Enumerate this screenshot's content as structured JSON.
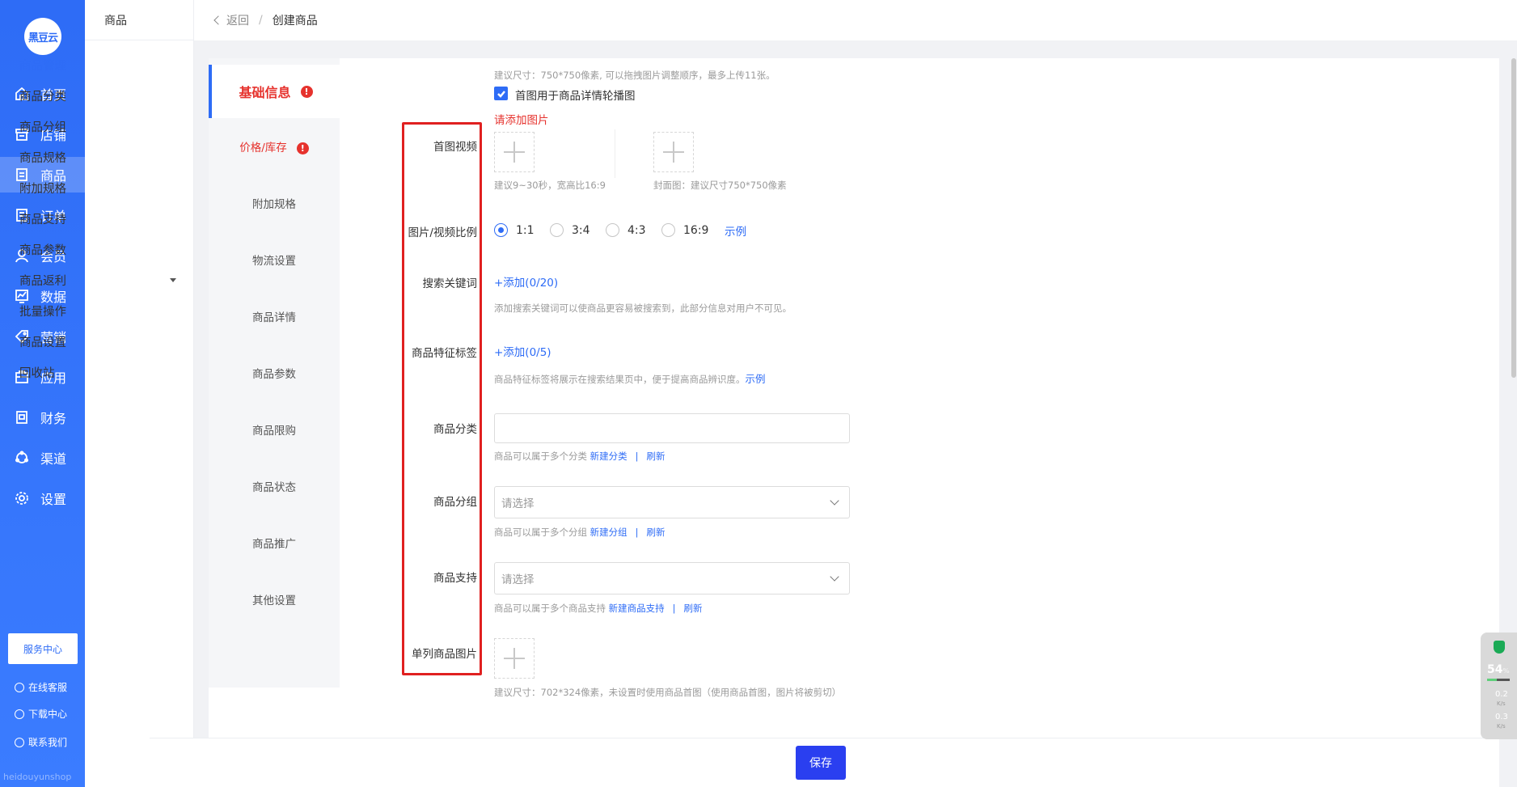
{
  "app": {
    "logo_text": "黑豆云",
    "footer_text": "heidouyunshop"
  },
  "nav": {
    "items": [
      {
        "label": "首页",
        "icon": "home-icon"
      },
      {
        "label": "店铺",
        "icon": "shop-icon"
      },
      {
        "label": "商品",
        "icon": "goods-icon",
        "active": true
      },
      {
        "label": "订单",
        "icon": "order-icon"
      },
      {
        "label": "会员",
        "icon": "member-icon"
      },
      {
        "label": "数据",
        "icon": "chart-icon"
      },
      {
        "label": "营销",
        "icon": "tag-icon"
      },
      {
        "label": "应用",
        "icon": "app-icon"
      },
      {
        "label": "财务",
        "icon": "finance-icon"
      },
      {
        "label": "渠道",
        "icon": "channel-icon"
      },
      {
        "label": "设置",
        "icon": "settings-icon"
      }
    ],
    "service_center": "服务中心",
    "online_service": "在线客服",
    "download_center": "下载中心",
    "contact_us": "联系我们"
  },
  "subnav": {
    "title": "商品",
    "items": [
      "商品管理",
      "商品分类",
      "商品分组",
      "商品规格",
      "附加规格",
      "商品支持",
      "商品参数",
      "商品返利",
      "批量操作",
      "商品设置",
      "回收站"
    ]
  },
  "topbar": {
    "back": "返回",
    "separator": "/",
    "current": "创建商品"
  },
  "tabs": [
    "基础信息",
    "价格/库存",
    "附加规格",
    "物流设置",
    "商品详情",
    "商品参数",
    "商品限购",
    "商品状态",
    "商品推广",
    "其他设置"
  ],
  "form": {
    "image_hint": "建议尺寸：750*750像素, 可以拖拽图片调整顺序，最多上传11张。",
    "carousel_checkbox_label": "首图用于商品详情轮播图",
    "add_image_error": "请添加图片",
    "video_label": "首图视频",
    "video_hint": "建议9~30秒，宽高比16:9",
    "cover_hint": "封面图：建议尺寸750*750像素",
    "ratio_label": "图片/视频比例",
    "ratio_options": [
      "1:1",
      "3:4",
      "4:3",
      "16:9"
    ],
    "ratio_selected": "1:1",
    "example": "示例",
    "keywords_label": "搜索关键词",
    "keywords_add": "+添加(0/20)",
    "keywords_hint": "添加搜索关键词可以使商品更容易被搜索到，此部分信息对用户不可见。",
    "tags_label": "商品特征标签",
    "tags_add": "+添加(0/5)",
    "tags_hint": "商品特征标签将展示在搜索结果页中，便于提高商品辨识度。",
    "category_label": "商品分类",
    "category_value": "",
    "category_hint": "商品可以属于多个分类",
    "new_category": "新建分类",
    "refresh": "刷新",
    "bar": "|",
    "group_label": "商品分组",
    "group_placeholder": "请选择",
    "group_hint": "商品可以属于多个分组",
    "new_group": "新建分组",
    "support_label": "商品支持",
    "support_placeholder": "请选择",
    "support_hint": "商品可以属于多个商品支持",
    "new_support": "新建商品支持",
    "single_image_label": "单列商品图片",
    "single_image_hint": "建议尺寸：702*324像素，未设置时使用商品首图（使用商品首图，图片将被剪切）"
  },
  "save_label": "保存",
  "widget": {
    "percent": "54",
    "percent_unit": "%",
    "up": "0.2",
    "down": "0.3",
    "unit": "K/s"
  },
  "colors": {
    "primary": "#2e6cf6",
    "danger": "#e6322d",
    "save": "#2a3ff0"
  }
}
